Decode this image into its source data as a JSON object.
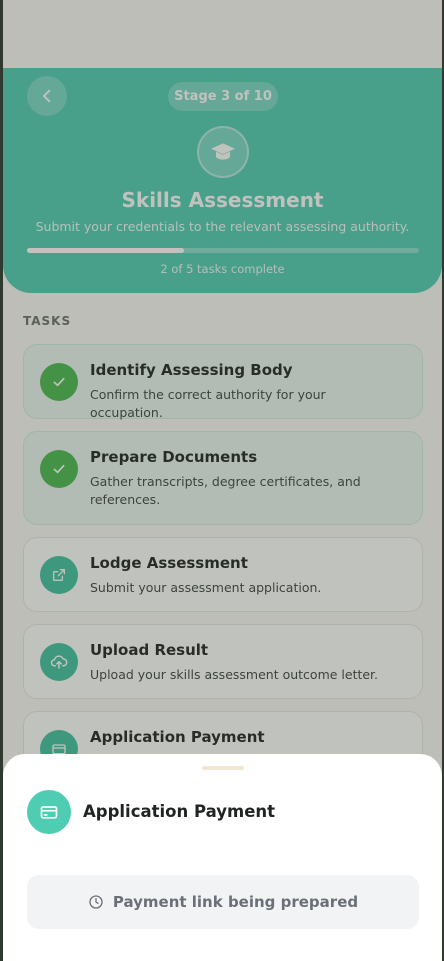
{
  "header": {
    "stage_label": "Stage 3 of 10",
    "title": "Skills Assessment",
    "subtitle": "Submit your credentials to the relevant assessing authority.",
    "progress_fraction": 0.4,
    "progress_text": "2 of 5 tasks complete",
    "accent_color": "#4ecdb3"
  },
  "tasks_section": {
    "label": "TASKS",
    "tasks": [
      {
        "title": "Identify Assessing Body",
        "description": "Confirm the correct authority for your occupation.",
        "status": "complete",
        "icon": "check-icon"
      },
      {
        "title": "Prepare Documents",
        "description": "Gather transcripts, degree certificates, and references.",
        "status": "complete",
        "icon": "check-icon"
      },
      {
        "title": "Lodge Assessment",
        "description": "Submit your assessment application.",
        "status": "pending",
        "icon": "external-link-icon"
      },
      {
        "title": "Upload Result",
        "description": "Upload your skills assessment outcome letter.",
        "status": "pending",
        "icon": "cloud-upload-icon"
      },
      {
        "title": "Application Payment",
        "description": "",
        "status": "pending",
        "icon": "credit-card-icon"
      }
    ]
  },
  "sheet": {
    "title": "Application Payment",
    "icon": "credit-card-icon",
    "status_text": "Payment link being prepared",
    "status_icon": "clock-icon"
  }
}
